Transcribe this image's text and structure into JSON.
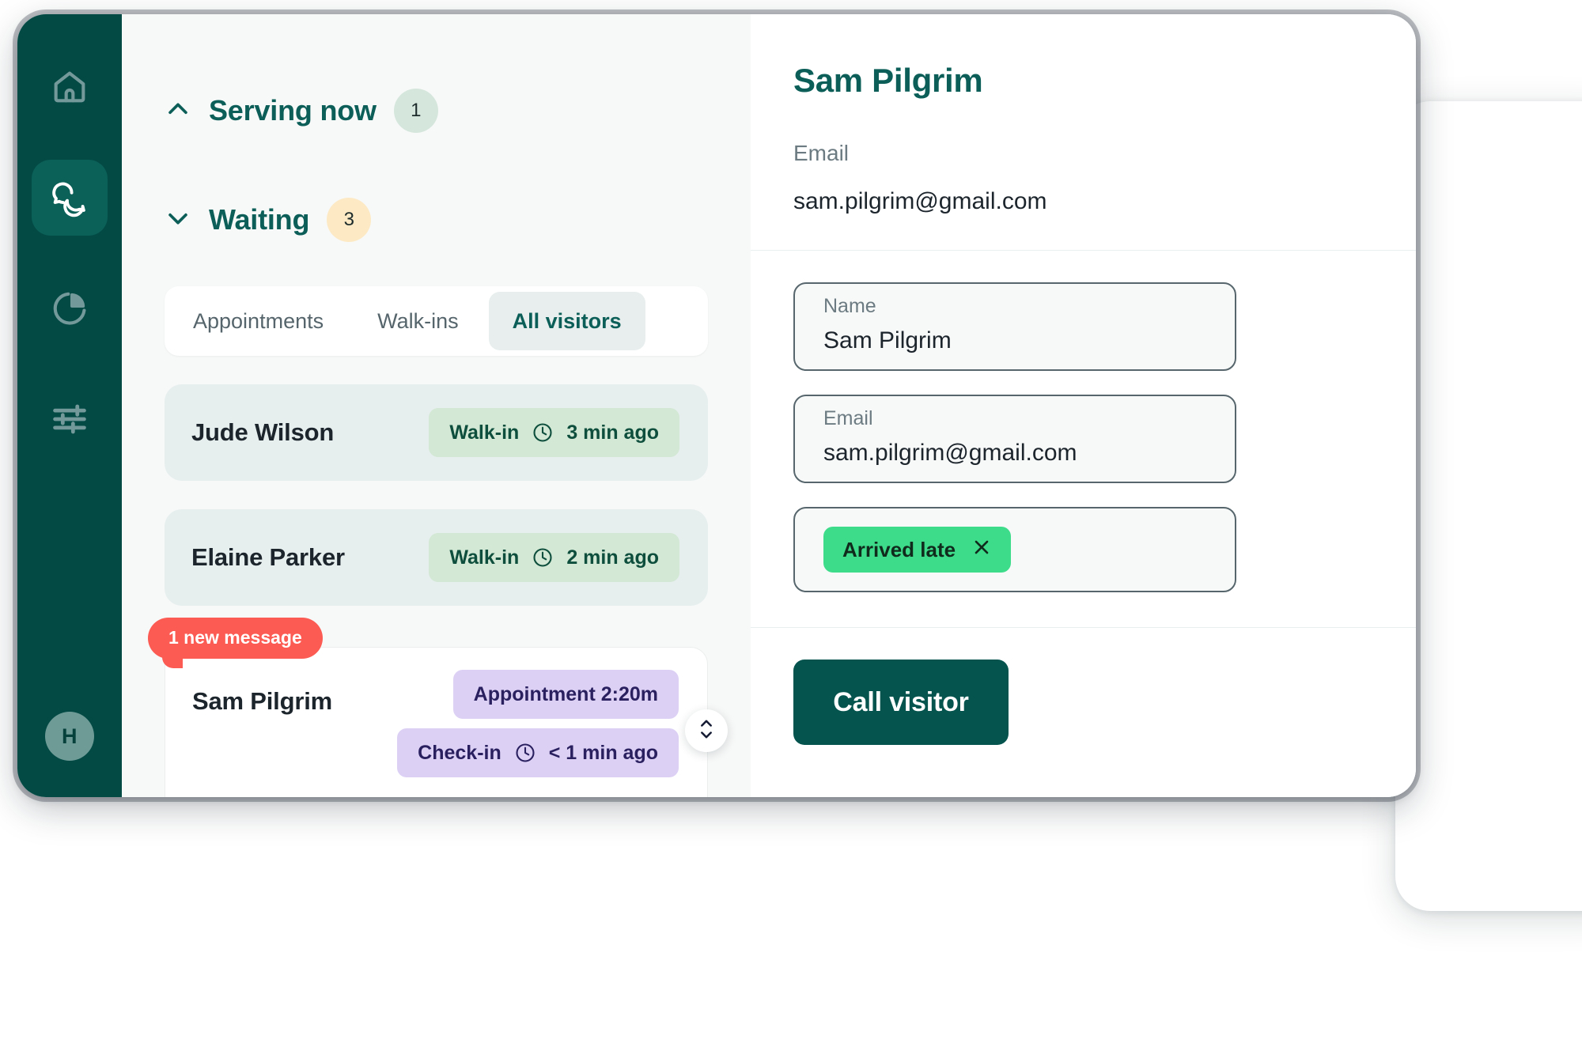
{
  "sidebar": {
    "items": [
      {
        "name": "home",
        "icon": "home-icon",
        "active": false
      },
      {
        "name": "queue",
        "icon": "chat-bubbles-icon",
        "active": true
      },
      {
        "name": "analytics",
        "icon": "pie-chart-icon",
        "active": false
      },
      {
        "name": "settings",
        "icon": "sliders-icon",
        "active": false
      }
    ],
    "avatar_initial": "H"
  },
  "queue": {
    "serving": {
      "title": "Serving now",
      "count": "1",
      "chevron": "chevron-up-icon"
    },
    "waiting": {
      "title": "Waiting",
      "count": "3",
      "chevron": "chevron-down-icon"
    },
    "tabs": [
      {
        "label": "Appointments",
        "active": false
      },
      {
        "label": "Walk-ins",
        "active": false
      },
      {
        "label": "All visitors",
        "active": true
      }
    ],
    "visitors": [
      {
        "name": "Jude Wilson",
        "chips": [
          {
            "type": "Walk-in",
            "icon": "clock-icon",
            "time": "3 min ago",
            "style": "green"
          }
        ]
      },
      {
        "name": "Elaine Parker",
        "chips": [
          {
            "type": "Walk-in",
            "icon": "clock-icon",
            "time": "2 min ago",
            "style": "green"
          }
        ]
      },
      {
        "name": "Sam Pilgrim",
        "badge": "1 new message",
        "chips": [
          {
            "type": "Appointment 2:20m",
            "icon": "",
            "time": "",
            "style": "purple"
          },
          {
            "type": "Check-in",
            "icon": "clock-icon",
            "time": "< 1 min ago",
            "style": "purple"
          }
        ]
      }
    ]
  },
  "detail": {
    "title": "Sam Pilgrim",
    "summary_label": "Email",
    "summary_value": "sam.pilgrim@gmail.com",
    "fields": [
      {
        "label": "Name",
        "value": "Sam Pilgrim"
      },
      {
        "label": "Email",
        "value": "sam.pilgrim@gmail.com"
      }
    ],
    "tag": {
      "label": "Arrived late",
      "remove_icon": "close-icon"
    },
    "call_button": "Call visitor"
  },
  "colors": {
    "brand_dark": "#034a45",
    "brand_active": "#0b6058",
    "brand_text": "#0b5f58",
    "badge_red": "#fb5b52",
    "tag_green": "#3ddc8b",
    "chip_green_bg": "#d3e8d5",
    "chip_purple_bg": "#dcd1f5",
    "count_green_bg": "#d5e7dd",
    "count_amber_bg": "#fdeac4",
    "panel_bg": "#f7f8f8",
    "card_bg": "#e6eeee"
  }
}
